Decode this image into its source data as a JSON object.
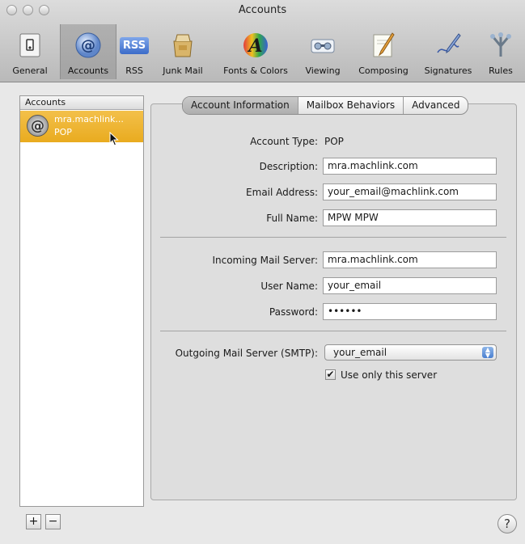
{
  "window": {
    "title": "Accounts"
  },
  "toolbar": {
    "items": [
      {
        "label": "General",
        "icon": "switch-icon"
      },
      {
        "label": "Accounts",
        "icon": "at-sign-icon"
      },
      {
        "label": "RSS",
        "icon": "rss-icon",
        "icon_text": "RSS"
      },
      {
        "label": "Junk Mail",
        "icon": "junk-mail-icon"
      },
      {
        "label": "Fonts & Colors",
        "icon": "font-color-icon",
        "icon_text": "A"
      },
      {
        "label": "Viewing",
        "icon": "viewing-icon"
      },
      {
        "label": "Composing",
        "icon": "pencil-icon"
      },
      {
        "label": "Signatures",
        "icon": "signature-pen-icon"
      },
      {
        "label": "Rules",
        "icon": "rules-icon"
      }
    ],
    "selected": "Accounts"
  },
  "sidebar": {
    "header": "Accounts",
    "accounts": [
      {
        "name": "mra.machlink...",
        "type": "POP",
        "icon_text": "@"
      }
    ],
    "add_label": "+",
    "remove_label": "−"
  },
  "tabs": [
    {
      "label": "Account Information",
      "active": true
    },
    {
      "label": "Mailbox Behaviors",
      "active": false
    },
    {
      "label": "Advanced",
      "active": false
    }
  ],
  "form": {
    "account_type_label": "Account Type:",
    "account_type_value": "POP",
    "description_label": "Description:",
    "description_value": "mra.machlink.com",
    "email_label": "Email Address:",
    "email_value": "your_email@machlink.com",
    "fullname_label": "Full Name:",
    "fullname_value": "MPW MPW",
    "incoming_label": "Incoming Mail Server:",
    "incoming_value": "mra.machlink.com",
    "username_label": "User Name:",
    "username_value": "your_email",
    "password_label": "Password:",
    "password_value": "••••••",
    "smtp_label": "Outgoing Mail Server (SMTP):",
    "smtp_value": "your_email",
    "use_only_label": "Use only this server",
    "use_only_checked": true
  },
  "help": {
    "label": "?"
  },
  "colors": {
    "selection": "#eeb32c",
    "accent": "#4a7fd0"
  }
}
